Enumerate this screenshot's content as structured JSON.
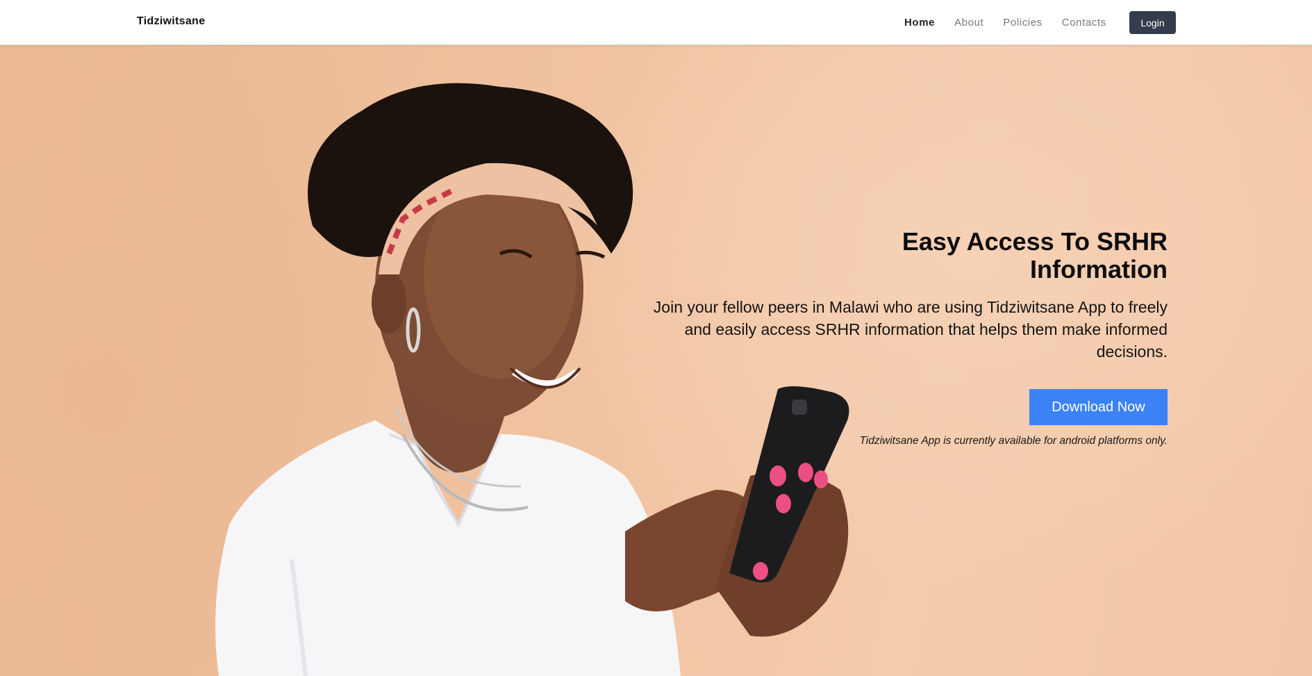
{
  "nav": {
    "brand": "Tidziwitsane",
    "links": [
      "Home",
      "About",
      "Policies",
      "Contacts"
    ],
    "login_label": "Login"
  },
  "hero": {
    "title": "Easy Access To SRHR Information",
    "description": "Join your fellow peers in Malawi who are using Tidziwitsane App to freely and easily access SRHR information that helps them make informed decisions.",
    "download_label": "Download Now",
    "availability_note": "Tidziwitsane App is currently available for android platforms only."
  },
  "colors": {
    "background": "#efc3a2",
    "login_button": "#343d4c",
    "download_button": "#3b82f6"
  }
}
